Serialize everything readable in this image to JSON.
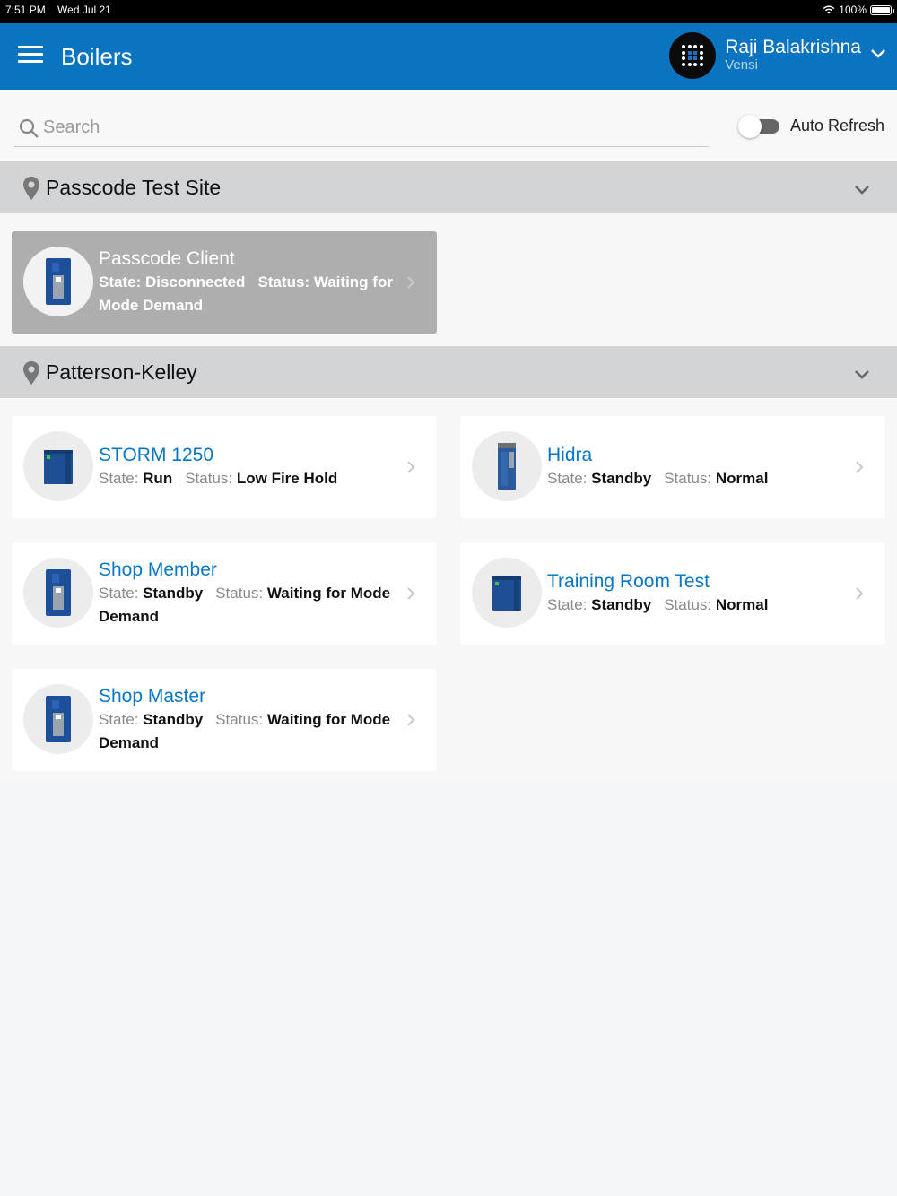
{
  "status_bar": {
    "time": "7:51 PM",
    "date": "Wed Jul 21",
    "battery": "100%"
  },
  "app_bar": {
    "title": "Boilers",
    "user_name": "Raji Balakrishna",
    "user_org": "Vensi"
  },
  "search": {
    "placeholder": "Search",
    "value": ""
  },
  "auto_refresh": {
    "label": "Auto Refresh",
    "on": false
  },
  "labels": {
    "state": "State:",
    "status": "Status:"
  },
  "sites": [
    {
      "name": "Passcode Test Site",
      "boilers": [
        {
          "name": "Passcode Client",
          "state": "Disconnected",
          "status": "Waiting for Mode Demand",
          "disabled": true,
          "icon": "boiler-icon"
        }
      ]
    },
    {
      "name": "Patterson-Kelley",
      "boilers": [
        {
          "name": "STORM 1250",
          "state": "Run",
          "status": "Low Fire Hold",
          "icon": "boiler-icon"
        },
        {
          "name": "Hidra",
          "state": "Standby",
          "status": "Normal",
          "icon": "boiler-icon"
        },
        {
          "name": "Shop Member",
          "state": "Standby",
          "status": "Waiting for Mode Demand",
          "icon": "boiler-icon"
        },
        {
          "name": "Training Room Test",
          "state": "Standby",
          "status": "Normal",
          "icon": "boiler-icon"
        },
        {
          "name": "Shop Master",
          "state": "Standby",
          "status": "Waiting for Mode Demand",
          "icon": "boiler-icon"
        }
      ]
    }
  ],
  "colors": {
    "app_bar": "#0b74c1",
    "link": "#0a77c4",
    "section": "#d3d4d6",
    "disabled_card": "#aeaeae"
  }
}
